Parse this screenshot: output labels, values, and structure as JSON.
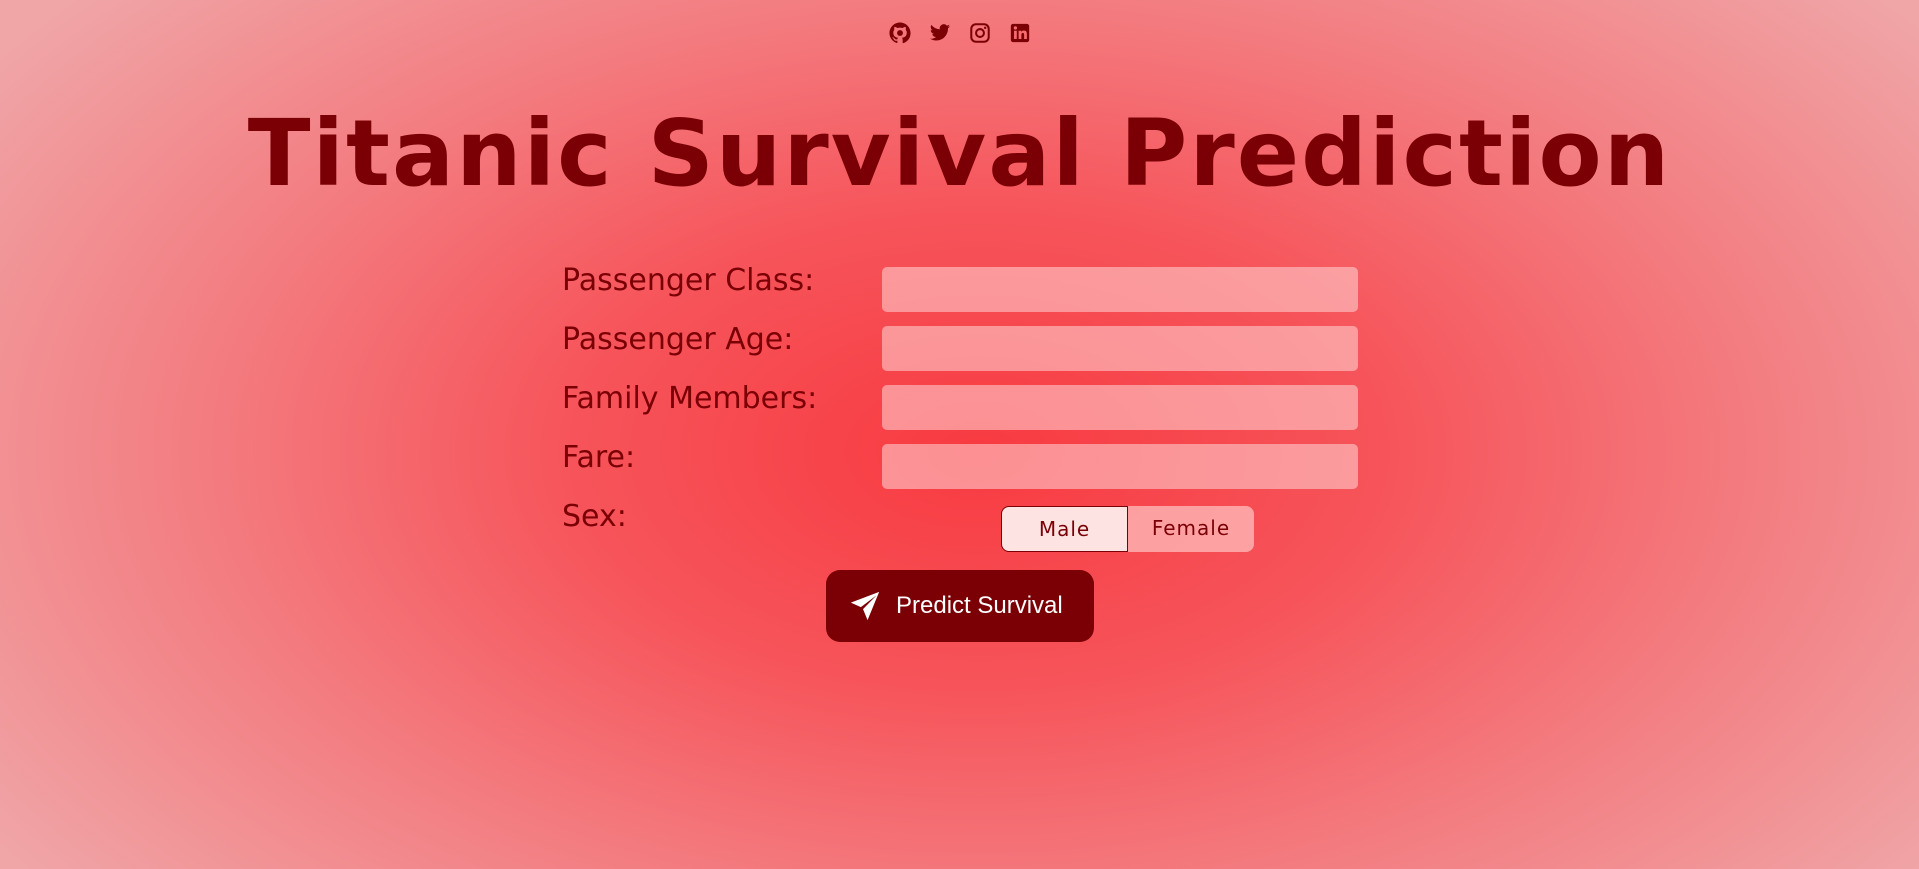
{
  "header": {
    "social_icons": [
      "github-icon",
      "twitter-icon",
      "instagram-icon",
      "linkedin-icon"
    ]
  },
  "title": "Titanic Survival Prediction",
  "form": {
    "fields": [
      {
        "label": "Passenger Class:",
        "value": ""
      },
      {
        "label": "Passenger Age:",
        "value": ""
      },
      {
        "label": "Family Members:",
        "value": ""
      },
      {
        "label": "Fare:",
        "value": ""
      }
    ],
    "sex": {
      "label": "Sex:",
      "options": [
        "Male",
        "Female"
      ],
      "selected": "Male"
    }
  },
  "submit": {
    "label": "Predict Survival",
    "icon": "send-icon"
  },
  "colors": {
    "accent": "#7a0005",
    "background_center": "#f83a41",
    "background_edge": "#f0a5a7",
    "input_bg": "#f99b9d"
  }
}
